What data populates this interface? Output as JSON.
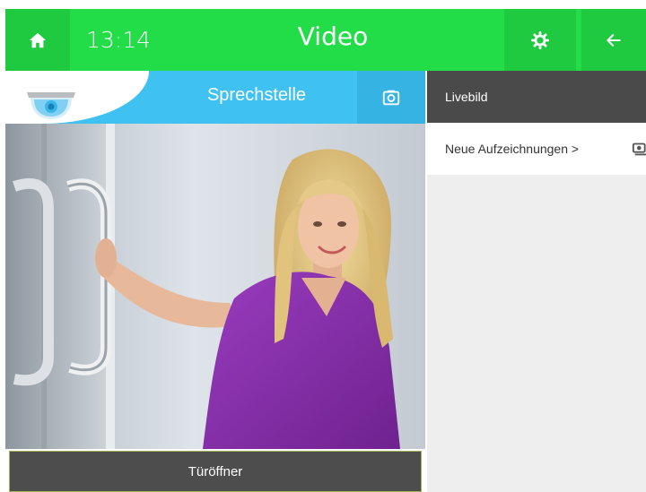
{
  "topbar": {
    "time": "13:14",
    "title": "Video"
  },
  "video_panel": {
    "header_title": "Sprechstelle",
    "door_button_label": "Türöffner"
  },
  "side_panel": {
    "header_label": "Livebild",
    "recordings_label": "Neue Aufzeichnungen >"
  },
  "colors": {
    "topbar_green": "#22dd48",
    "header_blue": "#3fc2f2",
    "dark_gray": "#4a4a4a"
  },
  "icons": [
    "home-icon",
    "settings-gear-icon",
    "back-arrow-icon",
    "snapshot-camera-icon",
    "camera-logo-icon",
    "recording-camera-icon"
  ]
}
